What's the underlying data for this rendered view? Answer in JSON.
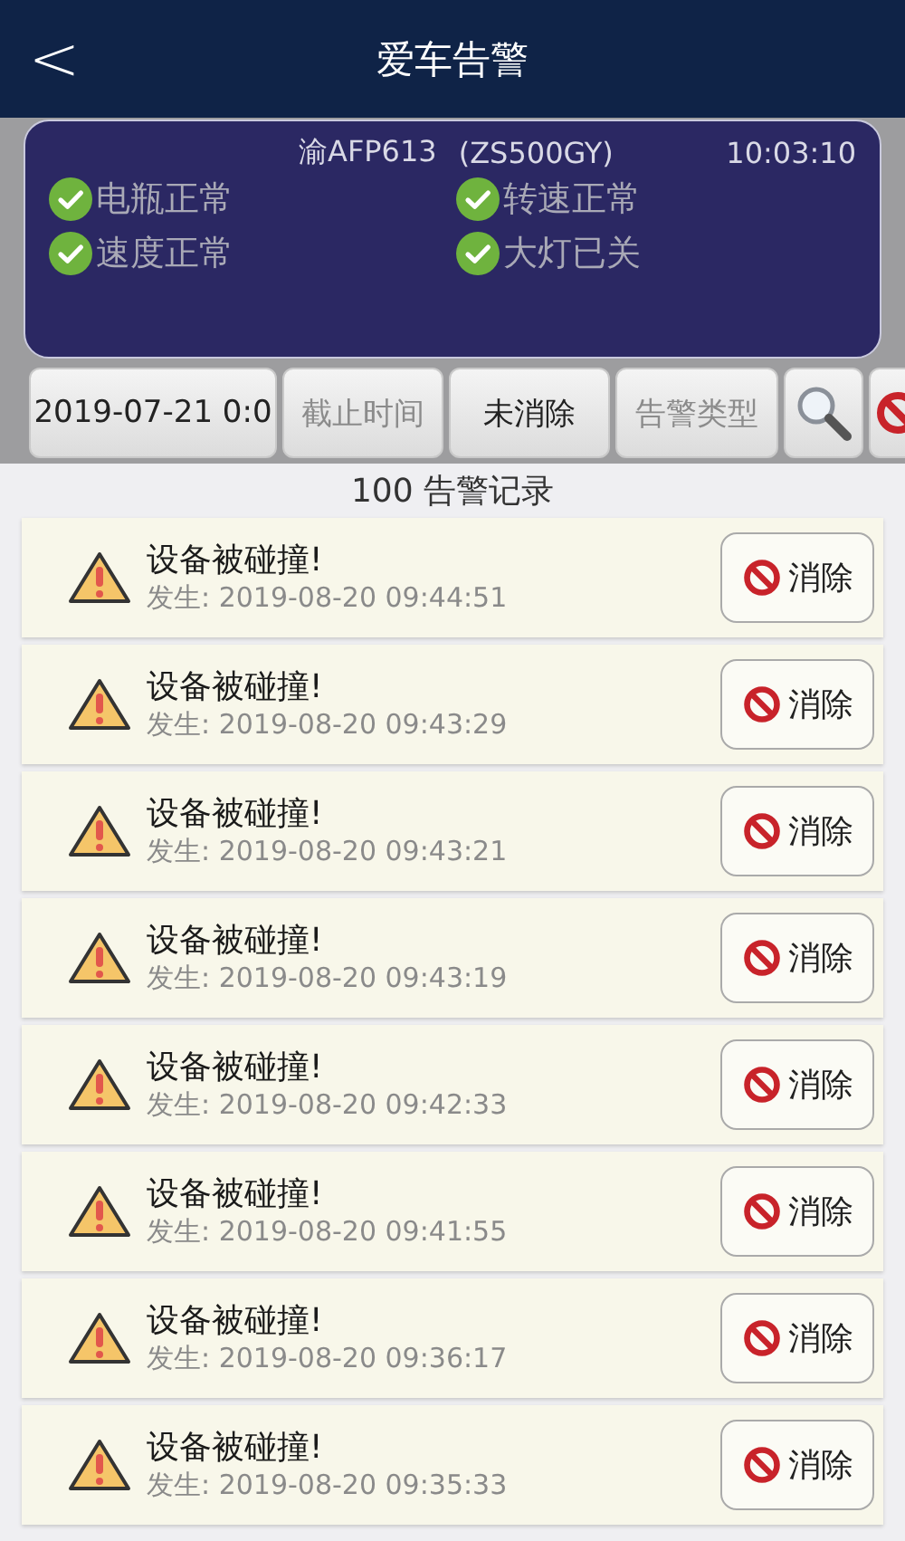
{
  "header": {
    "back": "<",
    "title": "爱车告警"
  },
  "vehicle": {
    "plate": "渝AFP613",
    "code": "(ZS500GY)",
    "time": "10:03:10",
    "statuses": [
      {
        "label": "电瓶正常",
        "ok": true
      },
      {
        "label": "转速正常",
        "ok": true
      },
      {
        "label": "速度正常",
        "ok": true
      },
      {
        "label": "大灯已关",
        "ok": true
      }
    ]
  },
  "filters": [
    {
      "value": "2019-07-21 0:0"
    },
    {
      "placeholder": "截止时间"
    },
    {
      "value": "未消除"
    },
    {
      "placeholder": "告警类型"
    }
  ],
  "list_title": "100 告警记录",
  "alarms": [
    {
      "title": "设备被碰撞!",
      "time": "发生: 2019-08-20 09:44:51",
      "action": "消除"
    },
    {
      "title": "设备被碰撞!",
      "time": "发生: 2019-08-20 09:43:29",
      "action": "消除"
    },
    {
      "title": "设备被碰撞!",
      "time": "发生: 2019-08-20 09:43:21",
      "action": "消除"
    },
    {
      "title": "设备被碰撞!",
      "time": "发生: 2019-08-20 09:43:19",
      "action": "消除"
    },
    {
      "title": "设备被碰撞!",
      "time": "发生: 2019-08-20 09:42:33",
      "action": "消除"
    },
    {
      "title": "设备被碰撞!",
      "time": "发生: 2019-08-20 09:41:55",
      "action": "消除"
    },
    {
      "title": "设备被碰撞!",
      "time": "发生: 2019-08-20 09:36:17",
      "action": "消除"
    },
    {
      "title": "设备被碰撞!",
      "time": "发生: 2019-08-20 09:35:33",
      "action": "消除"
    }
  ]
}
